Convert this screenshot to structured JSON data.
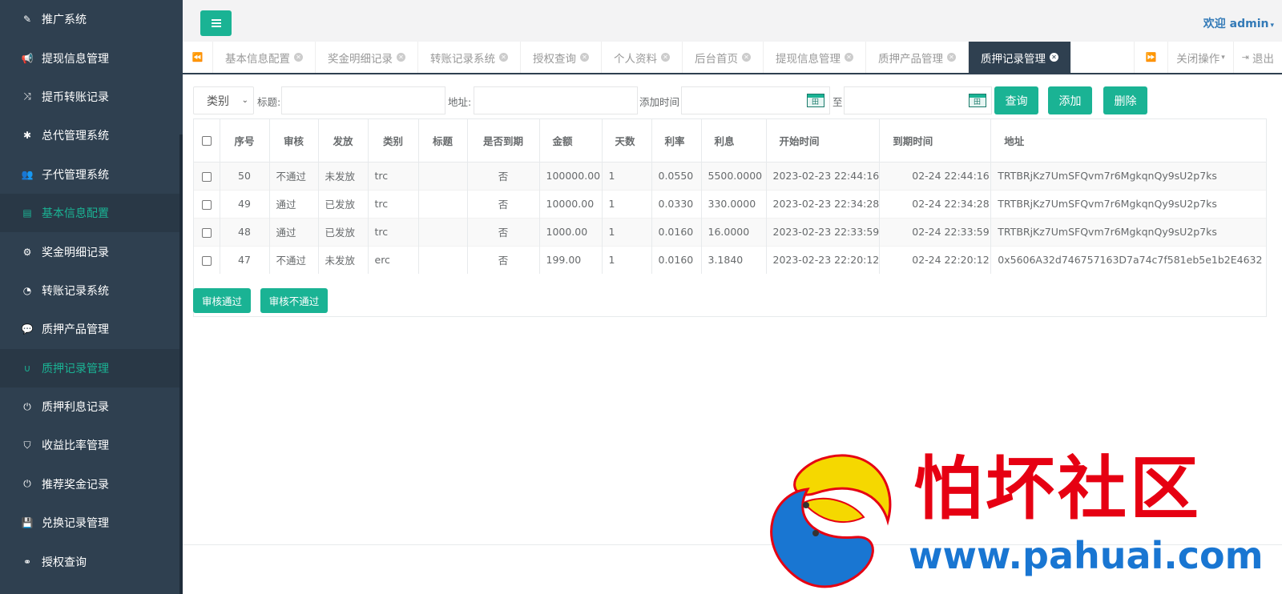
{
  "sidebar": {
    "items": [
      {
        "label": "推广系统",
        "icon": "edit-icon",
        "glyph": "✎"
      },
      {
        "label": "提现信息管理",
        "icon": "bullhorn-icon",
        "glyph": "📢"
      },
      {
        "label": "提币转账记录",
        "icon": "random-icon",
        "glyph": "⤨"
      },
      {
        "label": "总代管理系统",
        "icon": "asterisk-icon",
        "glyph": "✱"
      },
      {
        "label": "子代管理系统",
        "icon": "users-icon",
        "glyph": "👥"
      },
      {
        "label": "基本信息配置",
        "icon": "file-icon",
        "glyph": "▤",
        "active": true
      },
      {
        "label": "奖金明细记录",
        "icon": "cogs-icon",
        "glyph": "⚙"
      },
      {
        "label": "转账记录系统",
        "icon": "dashboard-icon",
        "glyph": "◔"
      },
      {
        "label": "质押产品管理",
        "icon": "comment-icon",
        "glyph": "💬"
      },
      {
        "label": "质押记录管理",
        "icon": "magnet-icon",
        "glyph": "∪",
        "active": true
      },
      {
        "label": "质押利息记录",
        "icon": "power-icon",
        "glyph": "⏻"
      },
      {
        "label": "收益比率管理",
        "icon": "shield-icon",
        "glyph": "⛉"
      },
      {
        "label": "推荐奖金记录",
        "icon": "power-icon",
        "glyph": "⏻"
      },
      {
        "label": "兑换记录管理",
        "icon": "save-icon",
        "glyph": "💾"
      },
      {
        "label": "授权查询",
        "icon": "binoculars-icon",
        "glyph": "⚭"
      }
    ]
  },
  "header": {
    "welcome": "欢迎 admin",
    "caret": "▾"
  },
  "tabs": {
    "prev_glyph": "⏪",
    "next_glyph": "⏩",
    "items": [
      {
        "label": "基本信息配置"
      },
      {
        "label": "奖金明细记录"
      },
      {
        "label": "转账记录系统"
      },
      {
        "label": "授权查询"
      },
      {
        "label": "个人资料"
      },
      {
        "label": "后台首页"
      },
      {
        "label": "提现信息管理"
      },
      {
        "label": "质押产品管理"
      },
      {
        "label": "质押记录管理",
        "active": true
      }
    ],
    "close_ops": "关闭操作",
    "logout": "退出"
  },
  "filter": {
    "category_select": "类别",
    "title_label": "标题:",
    "address_label": "地址:",
    "time_label": "添加时间",
    "to_label": "至",
    "query_btn": "查询",
    "add_btn": "添加",
    "delete_btn": "删除"
  },
  "table": {
    "headers": [
      "序号",
      "审核",
      "发放",
      "类别",
      "标题",
      "是否到期",
      "金额",
      "天数",
      "利率",
      "利息",
      "开始时间",
      "到期时间",
      "地址"
    ],
    "rows": [
      {
        "id": "50",
        "audit": "不通过",
        "issue": "未发放",
        "type": "trc",
        "title": "",
        "expired": "否",
        "amount": "100000.00",
        "days": "1",
        "rate": "0.0550",
        "interest": "5500.0000",
        "start": "2023-02-23 22:44:16",
        "end": "02-24 22:44:16",
        "address": "TRTBRjKz7UmSFQvm7r6MgkqnQy9sU2p7ks"
      },
      {
        "id": "49",
        "audit": "通过",
        "issue": "已发放",
        "type": "trc",
        "title": "",
        "expired": "否",
        "amount": "10000.00",
        "days": "1",
        "rate": "0.0330",
        "interest": "330.0000",
        "start": "2023-02-23 22:34:28",
        "end": "02-24 22:34:28",
        "address": "TRTBRjKz7UmSFQvm7r6MgkqnQy9sU2p7ks"
      },
      {
        "id": "48",
        "audit": "通过",
        "issue": "已发放",
        "type": "trc",
        "title": "",
        "expired": "否",
        "amount": "1000.00",
        "days": "1",
        "rate": "0.0160",
        "interest": "16.0000",
        "start": "2023-02-23 22:33:59",
        "end": "02-24 22:33:59",
        "address": "TRTBRjKz7UmSFQvm7r6MgkqnQy9sU2p7ks"
      },
      {
        "id": "47",
        "audit": "不通过",
        "issue": "未发放",
        "type": "erc",
        "title": "",
        "expired": "否",
        "amount": "199.00",
        "days": "1",
        "rate": "0.0160",
        "interest": "3.1840",
        "start": "2023-02-23 22:20:12",
        "end": "02-24 22:20:12",
        "address": "0x5606A32d746757163D7a74c7f581eb5e1b2E4632"
      }
    ]
  },
  "actions": {
    "approve_btn": "审核通过",
    "reject_btn": "审核不通过"
  },
  "watermark": {
    "text": "怕坏社区",
    "url": "www.pahuai.com"
  },
  "colors": {
    "accent": "#1ab394",
    "sidebar_bg": "#2f4050",
    "watermark_red": "#e60012",
    "watermark_blue": "#1976d2"
  }
}
